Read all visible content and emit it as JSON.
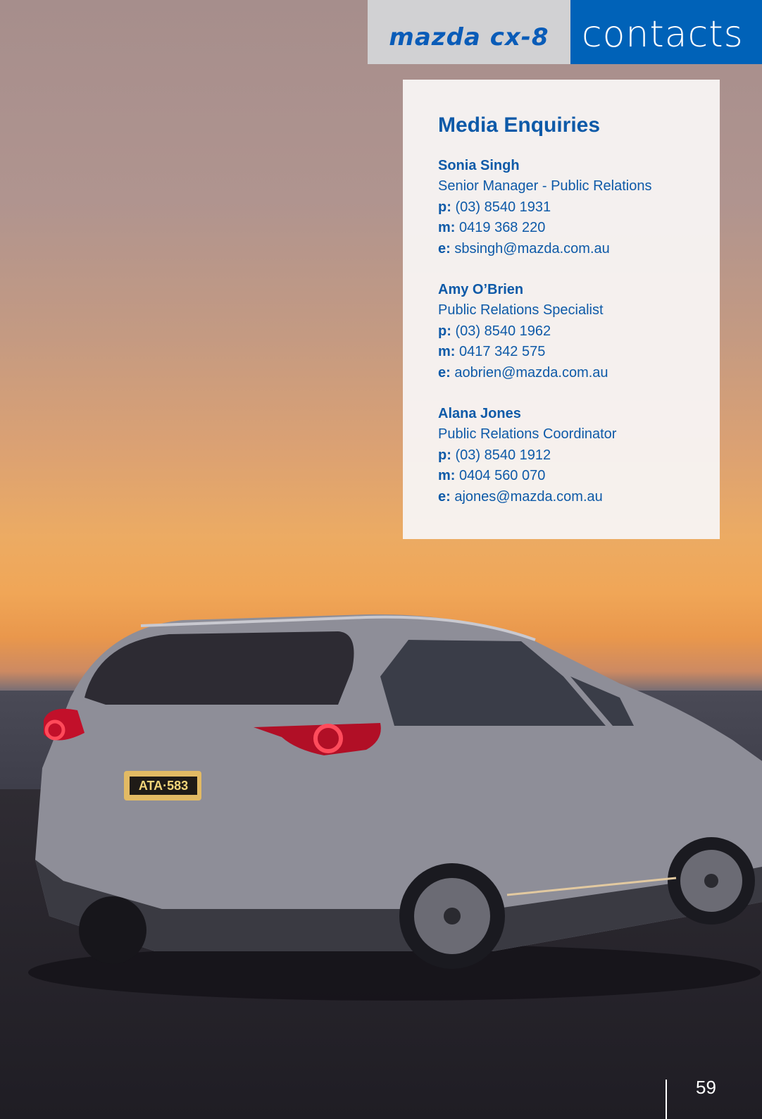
{
  "header": {
    "brand_logo": "mazda CX-8",
    "section_title": "contacts"
  },
  "card": {
    "title": "Media Enquiries",
    "contacts": [
      {
        "name": "Sonia Singh",
        "role": "Senior Manager - Public Relations",
        "phone_label": "p:",
        "phone": "(03) 8540 1931",
        "mobile_label": "m:",
        "mobile": "0419 368 220",
        "email_label": "e:",
        "email": "sbsingh@mazda.com.au"
      },
      {
        "name": "Amy O’Brien",
        "role": "Public Relations Specialist",
        "phone_label": "p:",
        "phone": "(03) 8540 1962",
        "mobile_label": "m:",
        "mobile": "0417 342 575",
        "email_label": "e:",
        "email": "aobrien@mazda.com.au"
      },
      {
        "name": "Alana Jones",
        "role": "Public Relations Coordinator",
        "phone_label": "p:",
        "phone": "(03) 8540 1912",
        "mobile_label": "m:",
        "mobile": "0404 560 070",
        "email_label": "e:",
        "email": "ajones@mazda.com.au"
      }
    ]
  },
  "photo": {
    "license_plate": "ATA·583"
  },
  "footer": {
    "page_number": "59"
  },
  "colors": {
    "brand_blue": "#0062b8",
    "text_blue": "#0e5aa8",
    "header_grey": "#d1d1d3"
  }
}
